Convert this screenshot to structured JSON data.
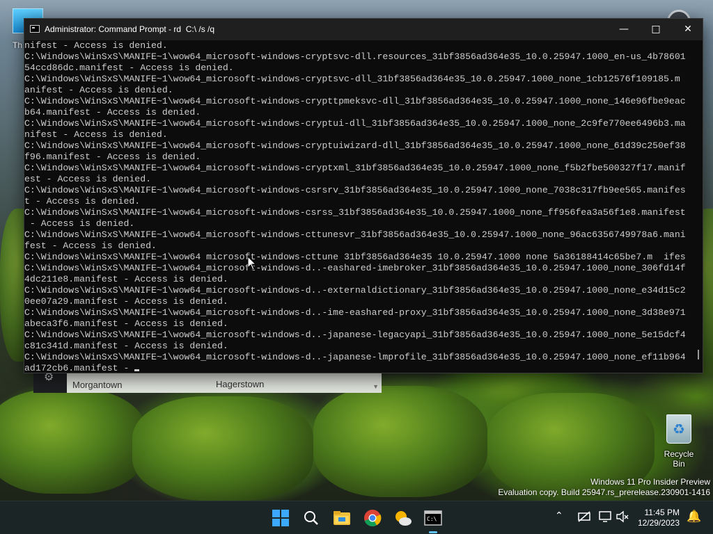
{
  "desktop": {
    "top_left_icon_label": "Th",
    "recycle_bin_label": "Recycle Bin",
    "watermark": {
      "line1": "Windows 11 Pro Insider Preview",
      "line2": "Evaluation copy. Build 25947.rs_prerelease.230901-1416"
    }
  },
  "map_widget": {
    "settings_icon": "gear-icon",
    "city_left": "Morgantown",
    "city_right": "Hagerstown"
  },
  "console": {
    "title": "Administrator: Command Prompt - rd  C:\\ /s /q",
    "lines": [
      "nifest - Access is denied.",
      "C:\\Windows\\WinSxS\\MANIFE~1\\wow64_microsoft-windows-cryptsvc-dll.resources_31bf3856ad364e35_10.0.25947.1000_en-us_4b78601",
      "54ccd86dc.manifest - Access is denied.",
      "C:\\Windows\\WinSxS\\MANIFE~1\\wow64_microsoft-windows-cryptsvc-dll_31bf3856ad364e35_10.0.25947.1000_none_1cb12576f109185.m",
      "anifest - Access is denied.",
      "C:\\Windows\\WinSxS\\MANIFE~1\\wow64_microsoft-windows-crypttpmeksvc-dll_31bf3856ad364e35_10.0.25947.1000_none_146e96fbe9eac",
      "b64.manifest - Access is denied.",
      "C:\\Windows\\WinSxS\\MANIFE~1\\wow64_microsoft-windows-cryptui-dll_31bf3856ad364e35_10.0.25947.1000_none_2c9fe770ee6496b3.ma",
      "nifest - Access is denied.",
      "C:\\Windows\\WinSxS\\MANIFE~1\\wow64_microsoft-windows-cryptuiwizard-dll_31bf3856ad364e35_10.0.25947.1000_none_61d39c250ef38",
      "f96.manifest - Access is denied.",
      "C:\\Windows\\WinSxS\\MANIFE~1\\wow64_microsoft-windows-cryptxml_31bf3856ad364e35_10.0.25947.1000_none_f5b2fbe500327f17.manif",
      "est - Access is denied.",
      "C:\\Windows\\WinSxS\\MANIFE~1\\wow64_microsoft-windows-csrsrv_31bf3856ad364e35_10.0.25947.1000_none_7038c317fb9ee565.manifes",
      "t - Access is denied.",
      "C:\\Windows\\WinSxS\\MANIFE~1\\wow64_microsoft-windows-csrss_31bf3856ad364e35_10.0.25947.1000_none_ff956fea3a56f1e8.manifest",
      " - Access is denied.",
      "C:\\Windows\\WinSxS\\MANIFE~1\\wow64_microsoft-windows-cttunesvr_31bf3856ad364e35_10.0.25947.1000_none_96ac6356749978a6.mani",
      "fest - Access is denied.",
      "C:\\Windows\\WinSxS\\MANIFE~1\\wow64 microsoft-windows-cttune 31bf3856ad364e35 10.0.25947.1000 none 5a36188414c65be7.m  ifes",
      "C:\\Windows\\WinSxS\\MANIFE~1\\wow64_microsoft-windows-d..-eashared-imebroker_31bf3856ad364e35_10.0.25947.1000_none_306fd14f",
      "4dc211e8.manifest - Access is denied.",
      "C:\\Windows\\WinSxS\\MANIFE~1\\wow64_microsoft-windows-d..-externaldictionary_31bf3856ad364e35_10.0.25947.1000_none_e34d15c2",
      "0ee07a29.manifest - Access is denied.",
      "C:\\Windows\\WinSxS\\MANIFE~1\\wow64_microsoft-windows-d..-ime-eashared-proxy_31bf3856ad364e35_10.0.25947.1000_none_3d38e971",
      "abeca3f6.manifest - Access is denied.",
      "C:\\Windows\\WinSxS\\MANIFE~1\\wow64_microsoft-windows-d..-japanese-legacyapi_31bf3856ad364e35_10.0.25947.1000_none_5e15dcf4",
      "c81c341d.manifest - Access is denied.",
      "C:\\Windows\\WinSxS\\MANIFE~1\\wow64_microsoft-windows-d..-japanese-lmprofile_31bf3856ad364e35_10.0.25947.1000_none_ef11b964",
      "ad172cb6.manifest - "
    ]
  },
  "taskbar": {
    "clock_time": "11:45 PM",
    "clock_date": "12/29/2023",
    "icons": {
      "start": "windows-start-icon",
      "search": "search-icon",
      "explorer": "file-explorer-icon",
      "chrome": "chrome-icon",
      "weather": "weather-icon",
      "terminal": "command-prompt-icon"
    },
    "tray": {
      "chevron": "chevron-up-icon",
      "network": "network-icon",
      "display": "display-icon",
      "volume": "volume-muted-icon",
      "notifications": "bell-icon"
    },
    "accent_color": "#62c3ff"
  }
}
